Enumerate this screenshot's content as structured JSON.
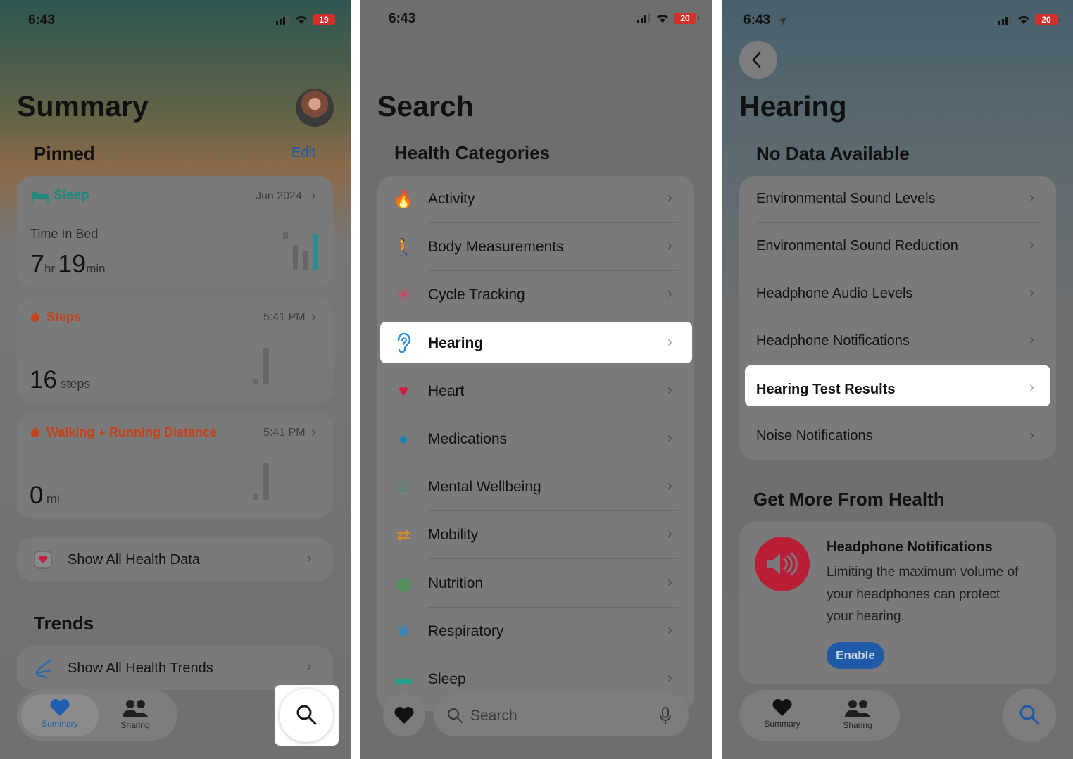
{
  "phone1": {
    "time": "6:43",
    "battery": "19",
    "title": "Summary",
    "pinned": {
      "heading": "Pinned",
      "edit": "Edit"
    },
    "sleep": {
      "label": "Sleep",
      "date": "Jun 2024",
      "metric": "Time In Bed",
      "hr": "7",
      "hr_unit": "hr",
      "min": "19",
      "min_unit": "min"
    },
    "steps": {
      "label": "Steps",
      "time": "5:41 PM",
      "value": "16",
      "unit": "steps"
    },
    "walk": {
      "label": "Walking + Running Distance",
      "time": "5:41 PM",
      "value": "0",
      "unit": "mi"
    },
    "show_all": "Show All Health Data",
    "trends": {
      "heading": "Trends",
      "show_all": "Show All Health Trends"
    },
    "tabs": {
      "summary": "Summary",
      "sharing": "Sharing"
    }
  },
  "phone2": {
    "time": "6:43",
    "battery": "20",
    "title": "Search",
    "section": "Health Categories",
    "items": [
      {
        "label": "Activity",
        "icon": "flame-icon",
        "color": "#d2461a"
      },
      {
        "label": "Body Measurements",
        "icon": "figure-icon",
        "color": "#7a3cc8"
      },
      {
        "label": "Cycle Tracking",
        "icon": "cycle-icon",
        "color": "#e03a55"
      },
      {
        "label": "Hearing",
        "icon": "ear-icon",
        "color": "#2c8fd8"
      },
      {
        "label": "Heart",
        "icon": "heart-icon",
        "color": "#d01c3a"
      },
      {
        "label": "Medications",
        "icon": "pills-icon",
        "color": "#1f7fb0"
      },
      {
        "label": "Mental Wellbeing",
        "icon": "head-icon",
        "color": "#2e8f8a"
      },
      {
        "label": "Mobility",
        "icon": "arrows-icon",
        "color": "#d98a2b"
      },
      {
        "label": "Nutrition",
        "icon": "apple-icon",
        "color": "#3aa04a"
      },
      {
        "label": "Respiratory",
        "icon": "lungs-icon",
        "color": "#2a8bc4"
      },
      {
        "label": "Sleep",
        "icon": "bed-icon",
        "color": "#23a08a"
      }
    ],
    "search_placeholder": "Search"
  },
  "phone3": {
    "time": "6:43",
    "battery": "20",
    "title": "Hearing",
    "section": "No Data Available",
    "items": [
      "Environmental Sound Levels",
      "Environmental Sound Reduction",
      "Headphone Audio Levels",
      "Headphone Notifications",
      "Hearing Test Results",
      "Noise Notifications"
    ],
    "more": {
      "heading": "Get More From Health",
      "card_title": "Headphone Notifications",
      "card_text_1": "Limiting the maximum volume of",
      "card_text_2": "your headphones can protect",
      "card_text_3": "your hearing.",
      "button": "Enable"
    },
    "tabs": {
      "summary": "Summary",
      "sharing": "Sharing"
    }
  }
}
